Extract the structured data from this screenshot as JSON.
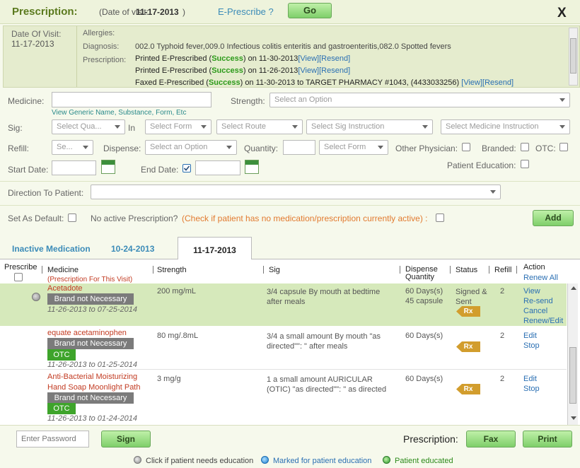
{
  "header": {
    "title": "Prescription:",
    "visit_label": "(Date of visit:",
    "visit_date": "11-17-2013",
    "visit_close": ")",
    "eprescribe": "E-Prescribe ?",
    "go": "Go",
    "close": "X"
  },
  "visit": {
    "date_label": "Date Of Visit:",
    "date": "11-17-2013",
    "allergies_label": "Allergies:",
    "diagnosis_label": "Diagnosis:",
    "diagnosis": "002.0 Typhoid fever,009.0 Infectious colitis enteritis and gastroenteritis,082.0 Spotted fevers",
    "prescription_label": "Prescription:",
    "history": [
      {
        "pre": "Printed E-Prescribed (",
        "status": "Success",
        "post": ") on 11-30-2013",
        "view": "[View]",
        "resend": "[Resend]"
      },
      {
        "pre": "Printed E-Prescribed (",
        "status": "Success",
        "post": ") on 11-26-2013",
        "view": "[View]",
        "resend": "[Resend]"
      },
      {
        "pre": "Faxed E-Prescribed (",
        "status": "Success",
        "post": ") on 11-30-2013 to TARGET PHARMACY #1043, (4433033256)",
        "view": "[View]",
        "resend": "[Resend]"
      }
    ]
  },
  "form": {
    "medicine_label": "Medicine:",
    "generic_link": "View Generic Name, Substance, Form, Etc",
    "strength_label": "Strength:",
    "strength_ph": "Select an Option",
    "sig_label": "Sig:",
    "qty_ph": "Select Qua...",
    "in_label": "In",
    "form_ph": "Select Form",
    "route_ph": "Select Route",
    "sig_ph": "Select Sig Instruction",
    "med_instr_ph": "Select Medicine Instruction",
    "refill_label": "Refill:",
    "refill_ph": "Se...",
    "dispense_label": "Dispense:",
    "dispense_ph": "Select an Option",
    "quantity_label": "Quantity:",
    "form2_ph": "Select Form",
    "other_physician": "Other Physician:",
    "branded": "Branded:",
    "otc": "OTC:",
    "start_date": "Start Date:",
    "end_date": "End Date:",
    "patient_education": "Patient Education:",
    "direction_label": "Direction To Patient:",
    "set_default": "Set As Default:",
    "no_active": "No active Prescription?",
    "no_active_hint": "(Check if patient has no medication/prescription currently active) :",
    "add": "Add"
  },
  "tabs": [
    {
      "label": "Inactive Medication"
    },
    {
      "label": "10-24-2013"
    },
    {
      "label": "11-17-2013"
    }
  ],
  "table": {
    "headers": {
      "prescribe": "Prescribe",
      "medicine": "Medicine",
      "medicine_sub": "(Prescription For This Visit)",
      "strength": "Strength",
      "sig": "Sig",
      "dispense": "Dispense",
      "dispense2": "Quantity",
      "status": "Status",
      "refill": "Refill",
      "action": "Action",
      "renew_all": "Renew All"
    },
    "rows": [
      {
        "name": "Acetadote",
        "brand": "Brand not Necessary",
        "dates": "11-26-2013 to 07-25-2014",
        "strength": "200 mg/mL",
        "sig": "3/4 capsule By mouth at bedtime after meals",
        "dispense": "60 Days(s)",
        "dispense2": "45 capsule",
        "status": "Signed & Sent",
        "rx": "Rx",
        "refill": "2",
        "actions": [
          "View",
          "Re-send",
          "Cancel",
          "Renew/Edit"
        ]
      },
      {
        "name": "equate acetaminophen",
        "brand": "Brand not Necessary",
        "otc": "OTC",
        "dates": "11-26-2013 to 01-25-2014",
        "strength": "80 mg/.8mL",
        "sig": "3/4 a small amount By mouth \"as directed\"\": \" after meals",
        "dispense": "60 Days(s)",
        "rx": "Rx",
        "refill": "2",
        "actions": [
          "Edit",
          "Stop"
        ]
      },
      {
        "name": "Anti-Bacterial Moisturizing Hand Soap Moonlight Path",
        "brand": "Brand not Necessary",
        "otc": "OTC",
        "dates": "11-26-2013 to 01-24-2014",
        "strength": "3 mg/g",
        "sig": "1 a small amount AURICULAR (OTIC) \"as directed\"\": \" as directed",
        "dispense": "60 Days(s)",
        "rx": "Rx",
        "refill": "2",
        "actions": [
          "Edit",
          "Stop"
        ]
      }
    ]
  },
  "footer": {
    "password_ph": "Enter Password",
    "sign": "Sign",
    "prescription_label": "Prescription:",
    "fax": "Fax",
    "print": "Print",
    "legend": [
      "Click if patient needs education",
      "Marked for patient education",
      "Patient educated"
    ]
  }
}
